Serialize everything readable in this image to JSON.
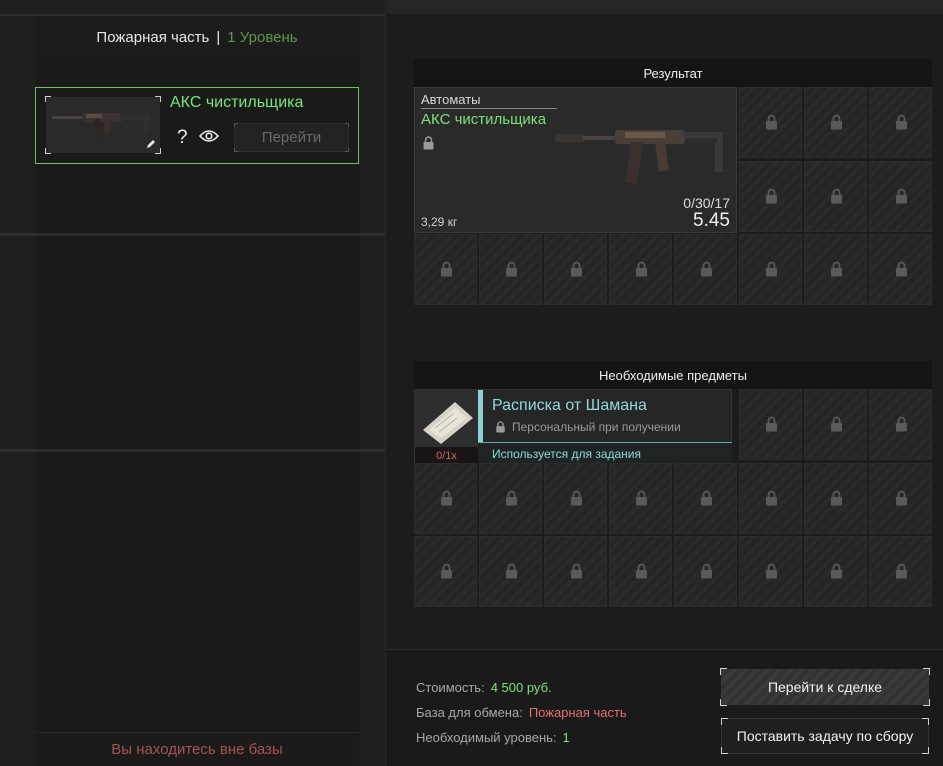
{
  "left_panel": {
    "header": {
      "station": "Пожарная часть",
      "separator": "|",
      "level": "1 Уровень"
    },
    "station_item": {
      "name": "АКС чистильщика",
      "help": "?",
      "goto_label": "Перейти"
    },
    "status": "Вы находитесь вне базы"
  },
  "result": {
    "title": "Результат",
    "item": {
      "category": "Автоматы",
      "name": "АКС чистильщика",
      "weight": "3,29 кг",
      "ammo": "0/30/17",
      "caliber": "5.45"
    }
  },
  "required": {
    "title": "Необходимые предметы",
    "item": {
      "name": "Расписка от Шамана",
      "personal": "Персональный при получении",
      "count": "0/1x",
      "usage": "Используется для задания"
    }
  },
  "footer": {
    "cost_label": "Стоимость:",
    "cost_value": "4 500 руб.",
    "base_label": "База для обмена:",
    "base_value": "Пожарная часть",
    "level_label": "Необходимый уровень:",
    "level_value": "1",
    "deal_button": "Перейти к сделке",
    "task_button": "Поставить задачу по сбору"
  },
  "icons": {
    "lock": "lock-icon",
    "eye": "eye-icon",
    "edit": "edit-icon"
  },
  "colors": {
    "accent_green": "#7be27a",
    "quest_cyan": "#8fd9d9",
    "alert_red": "#e4706c"
  }
}
